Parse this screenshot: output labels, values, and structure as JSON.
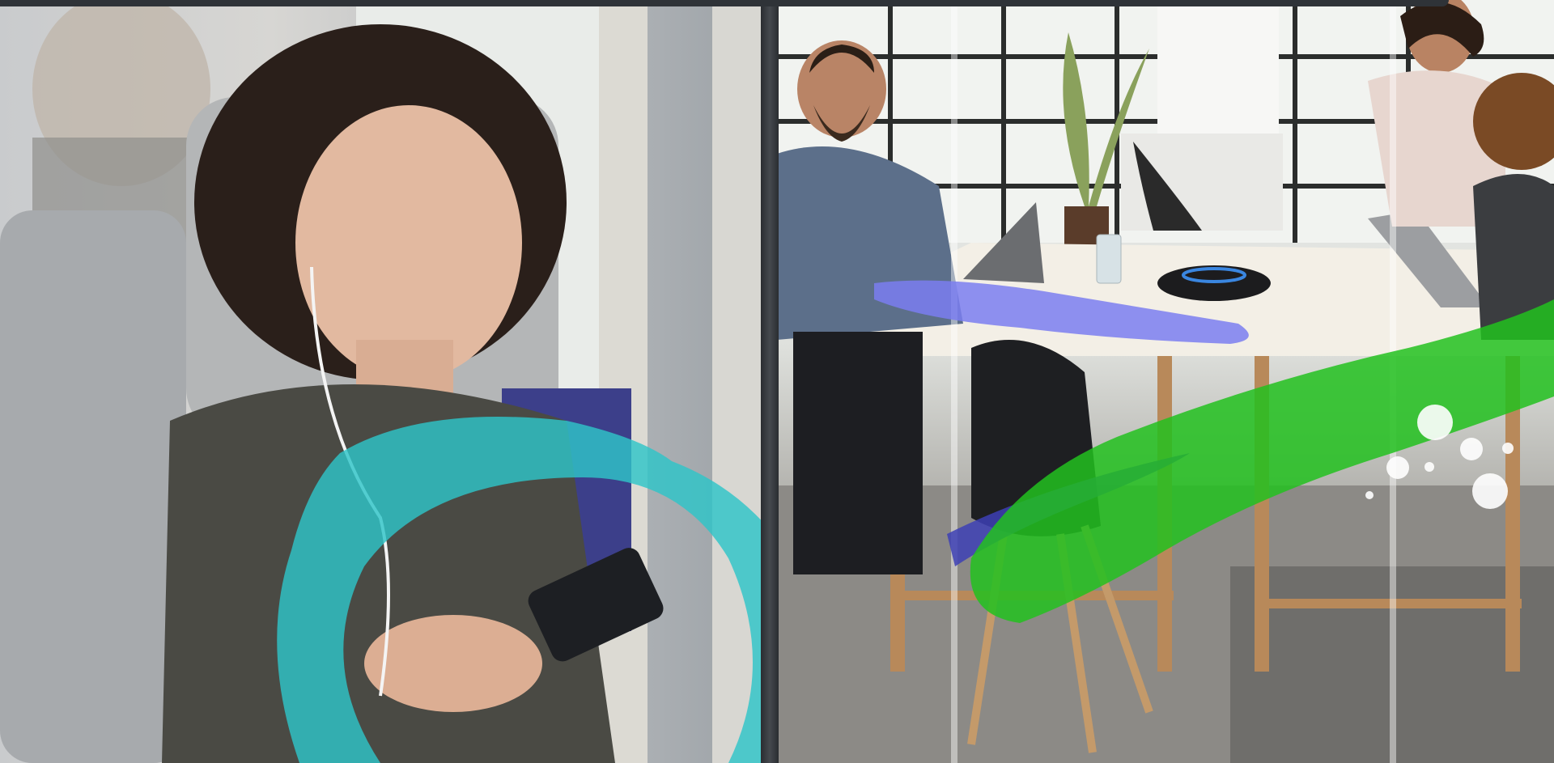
{
  "scene": {
    "left_photo": {
      "subject": "woman-with-phone-on-train",
      "dominant_color": "#c9cbcd"
    },
    "right_photo": {
      "subject": "meeting-room-with-table",
      "dominant_color": "#e6e8e4"
    },
    "brush_colors": {
      "teal": "#2ec4c8",
      "green": "#22c11e",
      "blue_violet": "#7a7ef0",
      "navy": "#3d3fb5",
      "white_dots": "#ffffff"
    }
  }
}
